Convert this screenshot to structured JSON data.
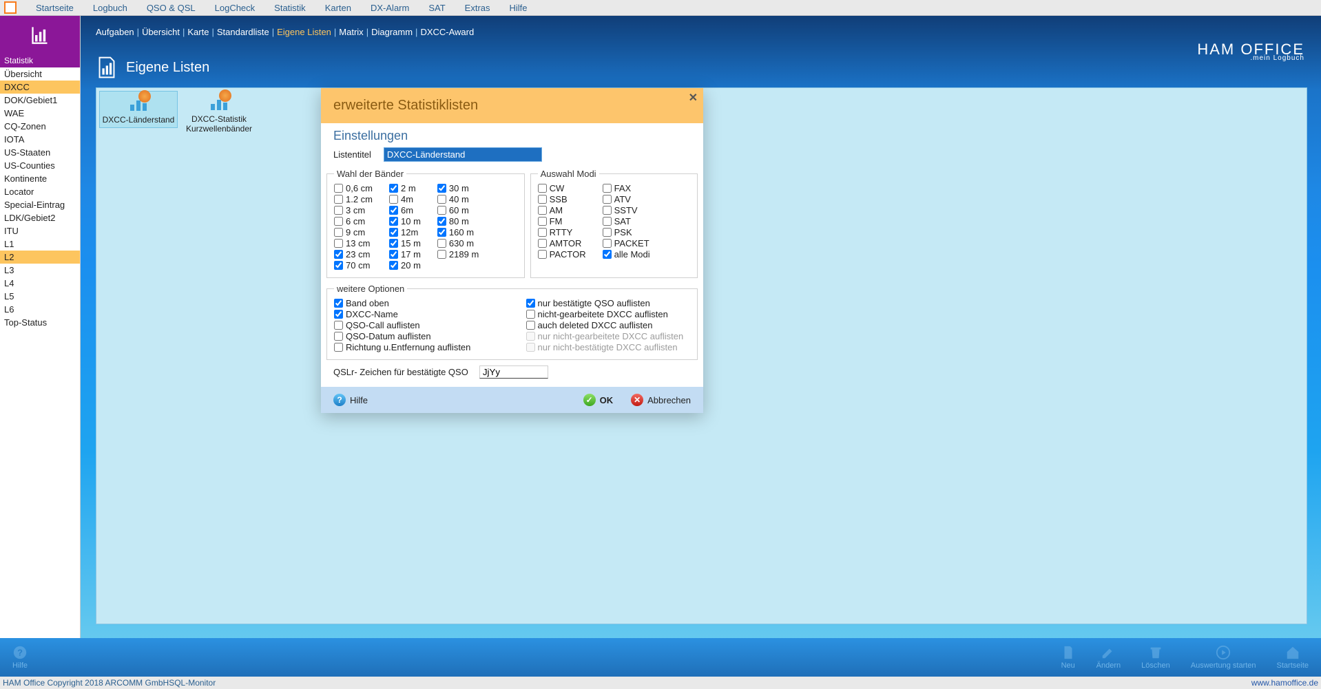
{
  "menubar": [
    "Startseite",
    "Logbuch",
    "QSO & QSL",
    "LogCheck",
    "Statistik",
    "Karten",
    "DX-Alarm",
    "SAT",
    "Extras",
    "Hilfe"
  ],
  "sidebar": {
    "title": "Statistik",
    "items": [
      "Übersicht",
      "DXCC",
      "DOK/Gebiet1",
      "WAE",
      "CQ-Zonen",
      "IOTA",
      "US-Staaten",
      "US-Counties",
      "Kontinente",
      "Locator",
      "Special-Eintrag",
      "LDK/Gebiet2",
      "ITU",
      "L1",
      "L2",
      "L3",
      "L4",
      "L5",
      "L6",
      "Top-Status"
    ],
    "selected": [
      "DXCC",
      "L2"
    ]
  },
  "subtabs": {
    "items": [
      "Aufgaben",
      "Übersicht",
      "Karte",
      "Standardliste",
      "Eigene Listen",
      "Matrix",
      "Diagramm",
      "DXCC-Award"
    ],
    "selected": "Eigene Listen"
  },
  "brand": {
    "name": "HAM OFFICE",
    "sub": ".mein Logbuch"
  },
  "page_title": "Eigene Listen",
  "listitems": [
    {
      "label": "DXCC-Länderstand",
      "selected": true
    },
    {
      "label": "DXCC-Statistik Kurzwellenbänder",
      "selected": false
    }
  ],
  "dialog": {
    "title": "erweiterte Statistiklisten",
    "section": "Einstellungen",
    "listentitel_label": "Listentitel",
    "listentitel_value": "DXCC-Länderstand",
    "bands_legend": "Wahl der Bänder",
    "bands": [
      [
        {
          "n": "0,6 cm",
          "c": false
        },
        {
          "n": "1.2 cm",
          "c": false
        },
        {
          "n": "3 cm",
          "c": false
        },
        {
          "n": "6 cm",
          "c": false
        },
        {
          "n": "9 cm",
          "c": false
        },
        {
          "n": "13 cm",
          "c": false
        },
        {
          "n": "23 cm",
          "c": true
        },
        {
          "n": "70 cm",
          "c": true
        }
      ],
      [
        {
          "n": "2 m",
          "c": true
        },
        {
          "n": "4m",
          "c": false
        },
        {
          "n": "6m",
          "c": true
        },
        {
          "n": "10 m",
          "c": true
        },
        {
          "n": "12m",
          "c": true
        },
        {
          "n": "15 m",
          "c": true
        },
        {
          "n": "17 m",
          "c": true
        },
        {
          "n": "20 m",
          "c": true
        }
      ],
      [
        {
          "n": "30 m",
          "c": true
        },
        {
          "n": "40 m",
          "c": false
        },
        {
          "n": "60 m",
          "c": false
        },
        {
          "n": "80 m",
          "c": true
        },
        {
          "n": "160 m",
          "c": true
        },
        {
          "n": "630 m",
          "c": false
        },
        {
          "n": "2189 m",
          "c": false
        }
      ]
    ],
    "modes_legend": "Auswahl Modi",
    "modes": [
      [
        {
          "n": "CW",
          "c": false
        },
        {
          "n": "SSB",
          "c": false
        },
        {
          "n": "AM",
          "c": false
        },
        {
          "n": "FM",
          "c": false
        },
        {
          "n": "RTTY",
          "c": false
        },
        {
          "n": "AMTOR",
          "c": false
        },
        {
          "n": "PACTOR",
          "c": false
        }
      ],
      [
        {
          "n": "FAX",
          "c": false
        },
        {
          "n": "ATV",
          "c": false
        },
        {
          "n": "SSTV",
          "c": false
        },
        {
          "n": "SAT",
          "c": false
        },
        {
          "n": "PSK",
          "c": false
        },
        {
          "n": "PACKET",
          "c": false
        },
        {
          "n": "alle Modi",
          "c": true
        }
      ]
    ],
    "opts_legend": "weitere Optionen",
    "opts_left": [
      {
        "n": "Band oben",
        "c": true
      },
      {
        "n": "DXCC-Name",
        "c": true
      },
      {
        "n": "QSO-Call auflisten",
        "c": false
      },
      {
        "n": "QSO-Datum auflisten",
        "c": false
      },
      {
        "n": "Richtung u.Entfernung auflisten",
        "c": false
      }
    ],
    "opts_right": [
      {
        "n": "nur bestätigte QSO auflisten",
        "c": true,
        "d": false
      },
      {
        "n": "nicht-gearbeitete DXCC auflisten",
        "c": false,
        "d": false
      },
      {
        "n": "auch deleted DXCC auflisten",
        "c": false,
        "d": false
      },
      {
        "n": "nur nicht-gearbeitete DXCC auflisten",
        "c": false,
        "d": true
      },
      {
        "n": "nur nicht-bestätigte DXCC auflisten",
        "c": false,
        "d": true
      }
    ],
    "qslr_label": "QSLr- Zeichen für bestätigte QSO",
    "qslr_value": "JjYy",
    "buttons": {
      "help": "Hilfe",
      "ok": "OK",
      "cancel": "Abbrechen"
    }
  },
  "toolbar": [
    "Hilfe",
    "Neu",
    "Ändern",
    "Löschen",
    "Auswertung starten",
    "Startseite"
  ],
  "footer": {
    "copy": "HAM Office Copyright 2018 ARCOMM GmbH",
    "sql": "SQL-Monitor",
    "link": "www.hamoffice.de"
  }
}
